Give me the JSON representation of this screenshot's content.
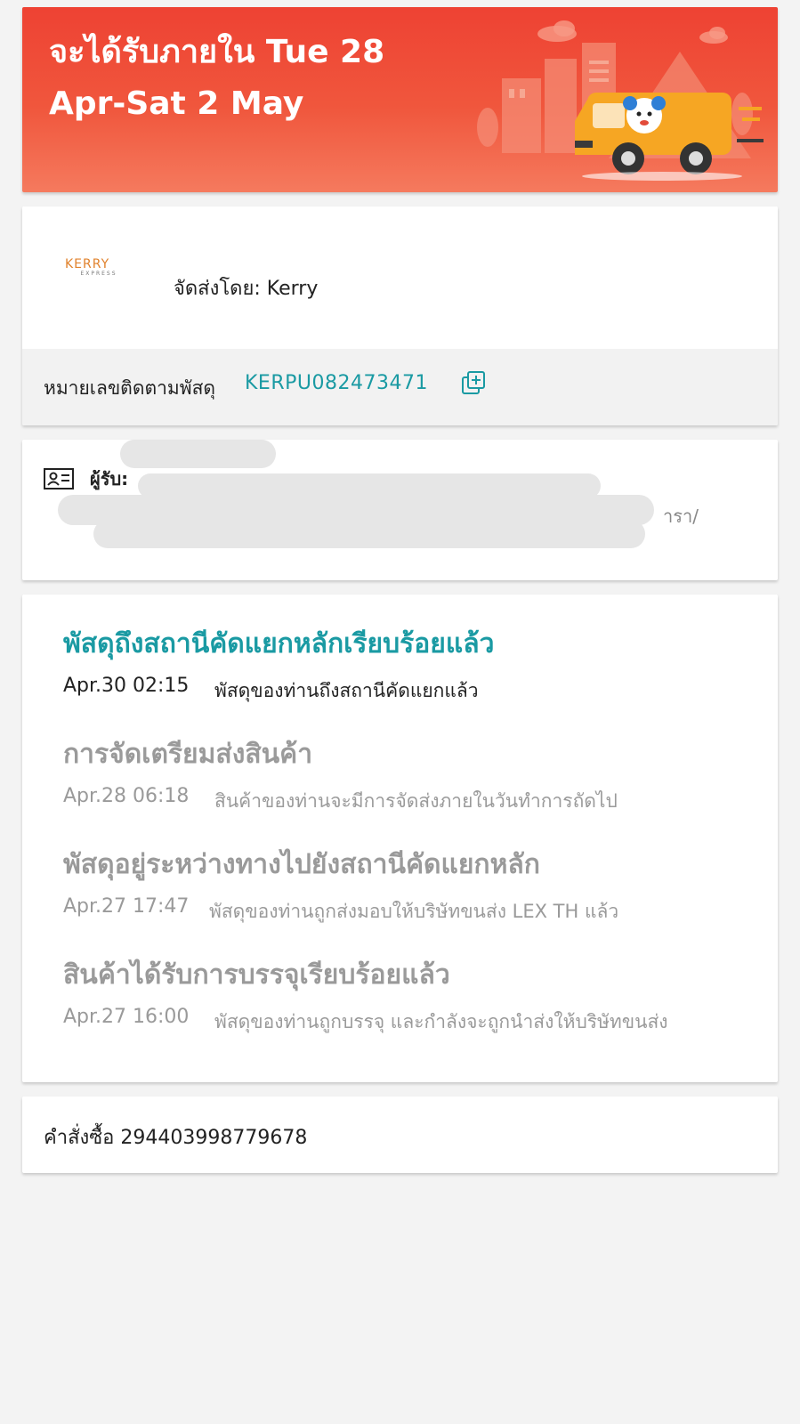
{
  "banner": {
    "delivery_text": "จะได้รับภายใน Tue 28 Apr-Sat 2 May",
    "colors": {
      "background": "#ee4233",
      "van": "#f6a623"
    }
  },
  "carrier": {
    "logo_text": "KERRY",
    "logo_subtext": "EXPRESS",
    "shipped_by": "จัดส่งโดย: Kerry",
    "tracking_label": "หมายเลขติดตามพัสดุ",
    "tracking_number": "KERPU082473471",
    "copy_icon": "copy-icon"
  },
  "recipient": {
    "label": "ผู้รับ:",
    "visible_address_tail": "ารา/",
    "icon": "id-card-icon"
  },
  "timeline": {
    "events": [
      {
        "title": "พัสดุถึงสถานีคัดแยกหลักเรียบร้อยแล้ว",
        "time": "Apr.30 02:15",
        "description": "พัสดุของท่านถึงสถานีคัดแยกแล้ว",
        "active": true
      },
      {
        "title": "การจัดเตรียมส่งสินค้า",
        "time": "Apr.28 06:18",
        "description": "สินค้าของท่านจะมีการจัดส่งภายในวันทำการถัดไป",
        "active": false
      },
      {
        "title": "พัสดุอยู่ระหว่างทางไปยังสถานีคัดแยกหลัก",
        "time": "Apr.27 17:47",
        "description": "พัสดุของท่านถูกส่งมอบให้บริษัทขนส่ง LEX TH แล้ว",
        "active": false
      },
      {
        "title": "สินค้าได้รับการบรรจุเรียบร้อยแล้ว",
        "time": "Apr.27 16:00",
        "description": "พัสดุของท่านถูกบรรจุ และกำลังจะถูกนำส่งให้บริษัทขนส่ง",
        "active": false
      }
    ],
    "colors": {
      "active": "#1a9aa3",
      "inactive": "#9a9a9a"
    }
  },
  "order": {
    "text": "คำสั่งซื้อ 294403998779678"
  }
}
